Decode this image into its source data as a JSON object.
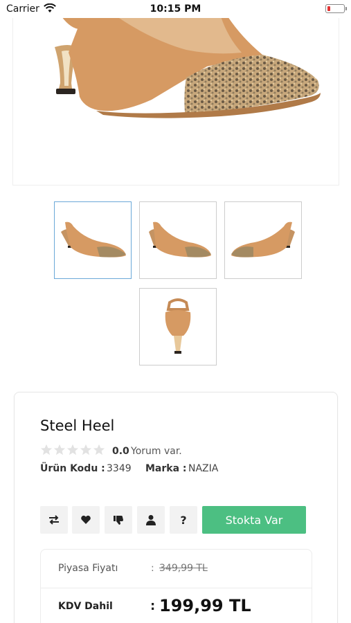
{
  "status_bar": {
    "carrier": "Carrier",
    "time": "10:15 PM",
    "wifi_icon": "wifi-icon",
    "battery_icon": "battery-low-icon",
    "battery_color": "#e33333"
  },
  "product": {
    "title": "Steel Heel",
    "rating_value": "0.0",
    "rating_stars": 0,
    "review_text": "Yorum var.",
    "code_label": "Ürün Kodu :",
    "code_value": "3349",
    "brand_label": "Marka :",
    "brand_value": "NAZIA"
  },
  "gallery": {
    "main_image": "shoe-main-image",
    "thumbnails": [
      "shoe-side-left",
      "shoe-side-right",
      "shoe-side-inner",
      "shoe-back"
    ],
    "active_index": 0
  },
  "actions": {
    "compare_icon": "compare-arrows-icon",
    "favorite_icon": "heart-icon",
    "dislike_icon": "thumbs-down-icon",
    "user_icon": "user-icon",
    "question_label": "?",
    "stock_label": "Stokta Var",
    "stock_color": "#4cbf82"
  },
  "pricing": {
    "market_label": "Piyasa Fiyatı",
    "colon": ":",
    "market_price": "349,99 TL",
    "kdv_label": "KDV Dahil",
    "kdv_price": "199,99 TL"
  }
}
